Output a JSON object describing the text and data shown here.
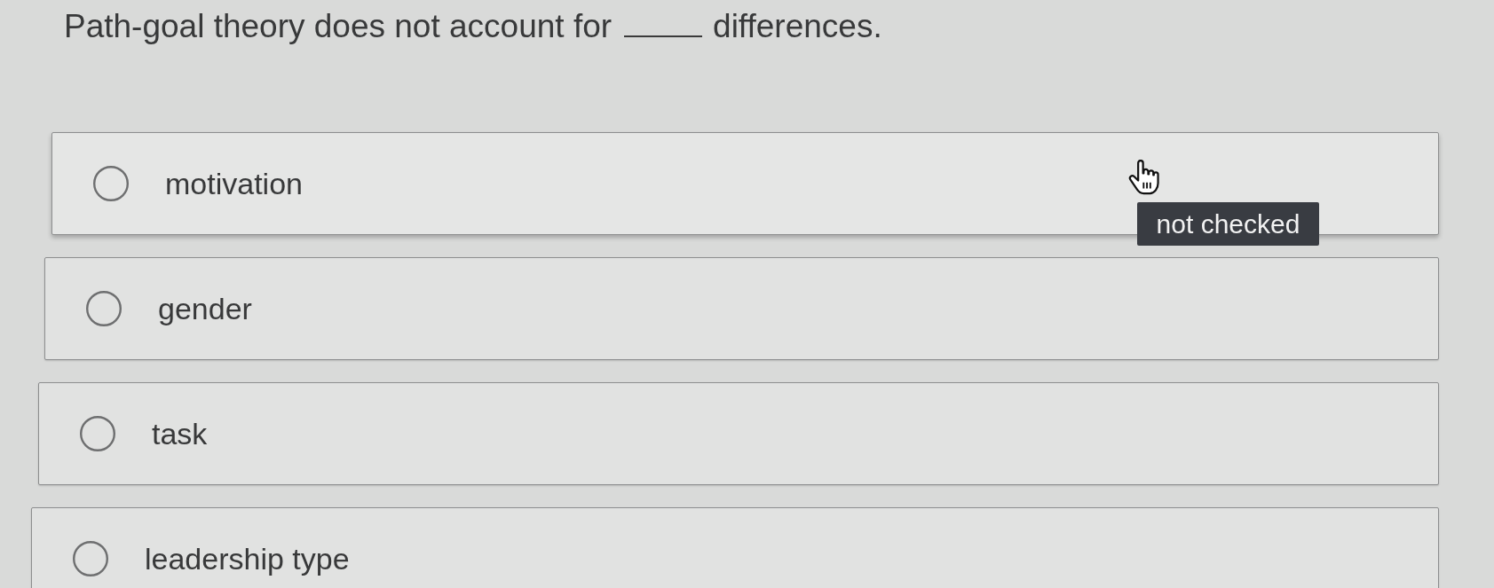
{
  "question": {
    "text_before": "Path-goal theory does not account for",
    "text_after": "differences."
  },
  "options": [
    {
      "label": "motivation",
      "selected": false,
      "hovered": true,
      "tooltip": "not checked"
    },
    {
      "label": "gender",
      "selected": false,
      "hovered": false
    },
    {
      "label": "task",
      "selected": false,
      "hovered": false
    },
    {
      "label": "leadership type",
      "selected": false,
      "hovered": false
    }
  ]
}
